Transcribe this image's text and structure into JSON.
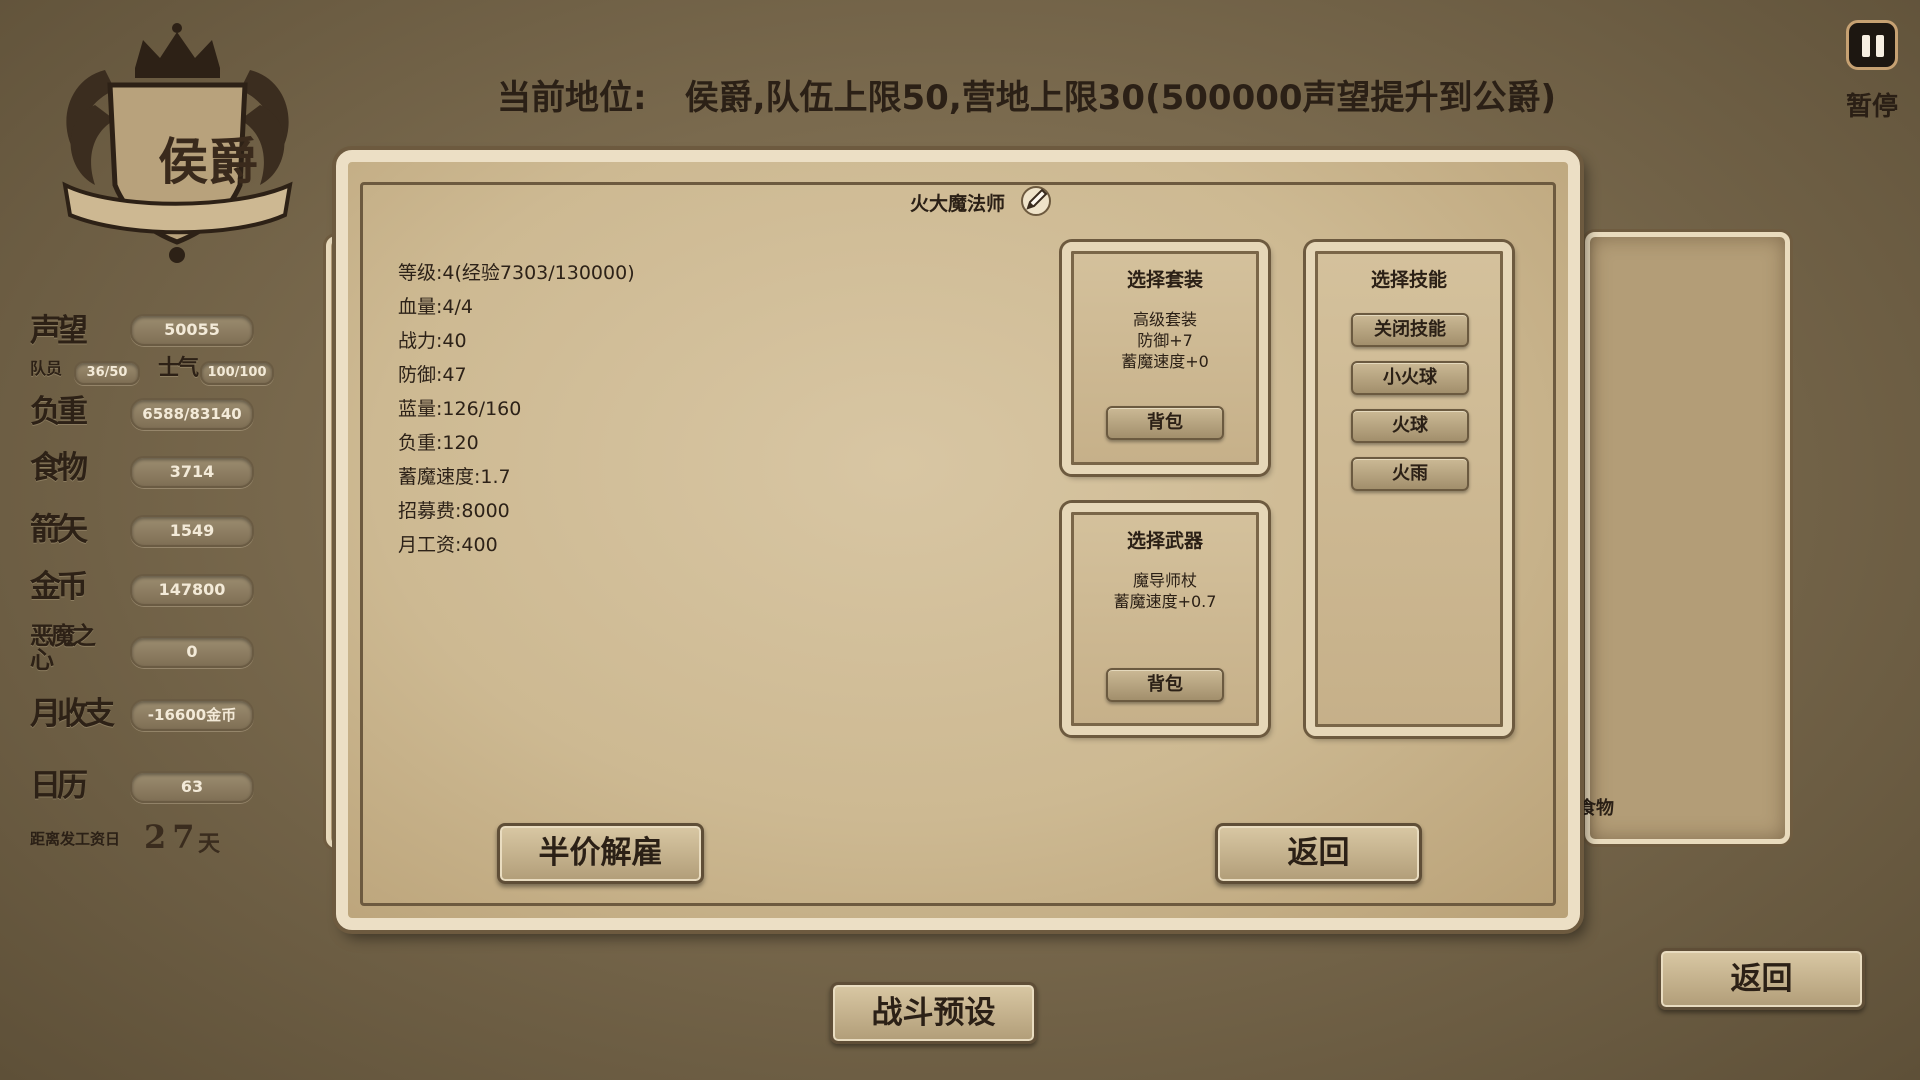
{
  "status": {
    "label": "当前地位:",
    "value": "侯爵,队伍上限50,营地上限30(500000声望提升到公爵)"
  },
  "rank": {
    "title": "侯爵"
  },
  "stats": {
    "reputation": {
      "label": "声望",
      "value": "50055"
    },
    "team": {
      "label": "队员",
      "value": "36/50"
    },
    "morale": {
      "label": "士气",
      "value": "100/100"
    },
    "load": {
      "label": "负重",
      "value": "6588/83140"
    },
    "food": {
      "label": "食物",
      "value": "3714"
    },
    "arrows": {
      "label": "箭矢",
      "value": "1549"
    },
    "gold": {
      "label": "金币",
      "value": "147800"
    },
    "demon_heart": {
      "label": "恶魔之心",
      "value": "0"
    },
    "monthly": {
      "label": "月收支",
      "value": "-16600金币"
    },
    "calendar": {
      "label": "日历",
      "value": "63"
    },
    "payday": {
      "label": "距离发工资日",
      "days": "27",
      "unit": "天"
    }
  },
  "pause": {
    "label": "暂停"
  },
  "unit": {
    "name": "火大魔法师",
    "info": [
      "等级:4(经验7303/130000)",
      "血量:4/4",
      "战力:40",
      "防御:47",
      "蓝量:126/160",
      "负重:120",
      "蓄魔速度:1.7",
      "招募费:8000",
      "月工资:400"
    ]
  },
  "armor_select": {
    "title": "选择套装",
    "desc": [
      "高级套装",
      "防御+7",
      "蓄魔速度+0"
    ],
    "button": "背包"
  },
  "weapon_select": {
    "title": "选择武器",
    "desc": [
      "魔导师杖",
      "蓄魔速度+0.7"
    ],
    "button": "背包"
  },
  "skill_select": {
    "title": "选择技能",
    "skills": [
      "关闭技能",
      "小火球",
      "火球",
      "火雨"
    ]
  },
  "buttons": {
    "dismiss": "半价解雇",
    "back_panel": "返回",
    "battle_preset": "战斗预设",
    "back_main": "返回"
  },
  "background_panel": {
    "food_label": "食物"
  }
}
